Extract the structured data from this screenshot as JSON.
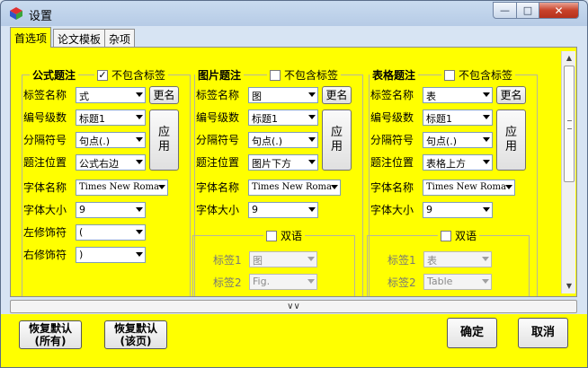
{
  "window": {
    "title": "设置"
  },
  "tabs": [
    {
      "label": "首选项"
    },
    {
      "label": "论文模板"
    },
    {
      "label": "杂项"
    }
  ],
  "groups": {
    "formula": {
      "title": "公式题注",
      "exclude_label": "不包含标签",
      "exclude_checked": true,
      "label_name": {
        "label": "标签名称",
        "value": "式"
      },
      "rename_label": "更名",
      "numbering_level": {
        "label": "编号级数",
        "value": "标题1"
      },
      "separator": {
        "label": "分隔符号",
        "value": "句点(.)"
      },
      "caption_position": {
        "label": "题注位置",
        "value": "公式右边"
      },
      "apply_label_1": "应",
      "apply_label_2": "用",
      "font_name": {
        "label": "字体名称",
        "value": "Times New Roma"
      },
      "font_size": {
        "label": "字体大小",
        "value": "9"
      },
      "left_decorator": {
        "label": "左修饰符",
        "value": "("
      },
      "right_decorator": {
        "label": "右修饰符",
        "value": ")"
      }
    },
    "figure": {
      "title": "图片题注",
      "exclude_label": "不包含标签",
      "exclude_checked": false,
      "label_name": {
        "label": "标签名称",
        "value": "图"
      },
      "rename_label": "更名",
      "numbering_level": {
        "label": "编号级数",
        "value": "标题1"
      },
      "separator": {
        "label": "分隔符号",
        "value": "句点(.)"
      },
      "caption_position": {
        "label": "题注位置",
        "value": "图片下方"
      },
      "apply_label_1": "应",
      "apply_label_2": "用",
      "font_name": {
        "label": "字体名称",
        "value": "Times New Roma"
      },
      "font_size": {
        "label": "字体大小",
        "value": "9"
      },
      "bilingual": {
        "label": "双语",
        "checked": false,
        "label1": {
          "label": "标签1",
          "value": "图"
        },
        "label2": {
          "label": "标签2",
          "value": "Fig."
        }
      }
    },
    "table": {
      "title": "表格题注",
      "exclude_label": "不包含标签",
      "exclude_checked": false,
      "label_name": {
        "label": "标签名称",
        "value": "表"
      },
      "rename_label": "更名",
      "numbering_level": {
        "label": "编号级数",
        "value": "标题1"
      },
      "separator": {
        "label": "分隔符号",
        "value": "句点(.)"
      },
      "caption_position": {
        "label": "题注位置",
        "value": "表格上方"
      },
      "apply_label_1": "应",
      "apply_label_2": "用",
      "font_name": {
        "label": "字体名称",
        "value": "Times New Roma"
      },
      "font_size": {
        "label": "字体大小",
        "value": "9"
      },
      "bilingual": {
        "label": "双语",
        "checked": false,
        "label1": {
          "label": "标签1",
          "value": "表"
        },
        "label2": {
          "label": "标签2",
          "value": "Table"
        }
      }
    }
  },
  "bottom": {
    "restore_all_line1": "恢复默认",
    "restore_all_line2": "(所有)",
    "restore_page_line1": "恢复默认",
    "restore_page_line2": "(该页)",
    "ok": "确定",
    "cancel": "取消"
  },
  "colors": {
    "panel_bg": "#ffff00",
    "window_frame": "#b6cbe6"
  },
  "icons": {
    "expand": "double-chevron-down-icon"
  }
}
